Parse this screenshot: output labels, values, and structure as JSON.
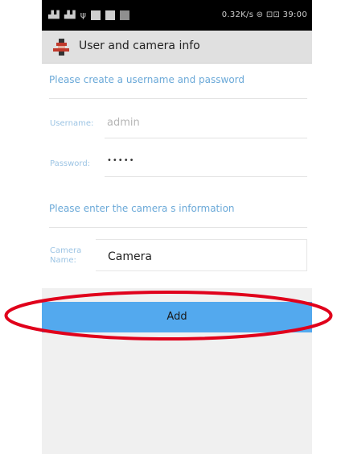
{
  "status_bar": {
    "right_text": "0.32K/s  ⊜  ⊡⊡  39:00"
  },
  "header": {
    "title": "User and camera info"
  },
  "user_section": {
    "prompt": "Please create a username and password",
    "username_label": "Username:",
    "username_value": "admin",
    "password_label": "Password:",
    "password_value": "•••••"
  },
  "camera_section": {
    "prompt": "Please enter the camera s information",
    "name_label_line1": "Camera",
    "name_label_line2": "Name:",
    "name_value": "Camera"
  },
  "actions": {
    "add_label": "Add"
  },
  "colors": {
    "accent": "#53a9ee",
    "prompt_text": "#6ba9d8",
    "highlight": "#e0001b"
  }
}
